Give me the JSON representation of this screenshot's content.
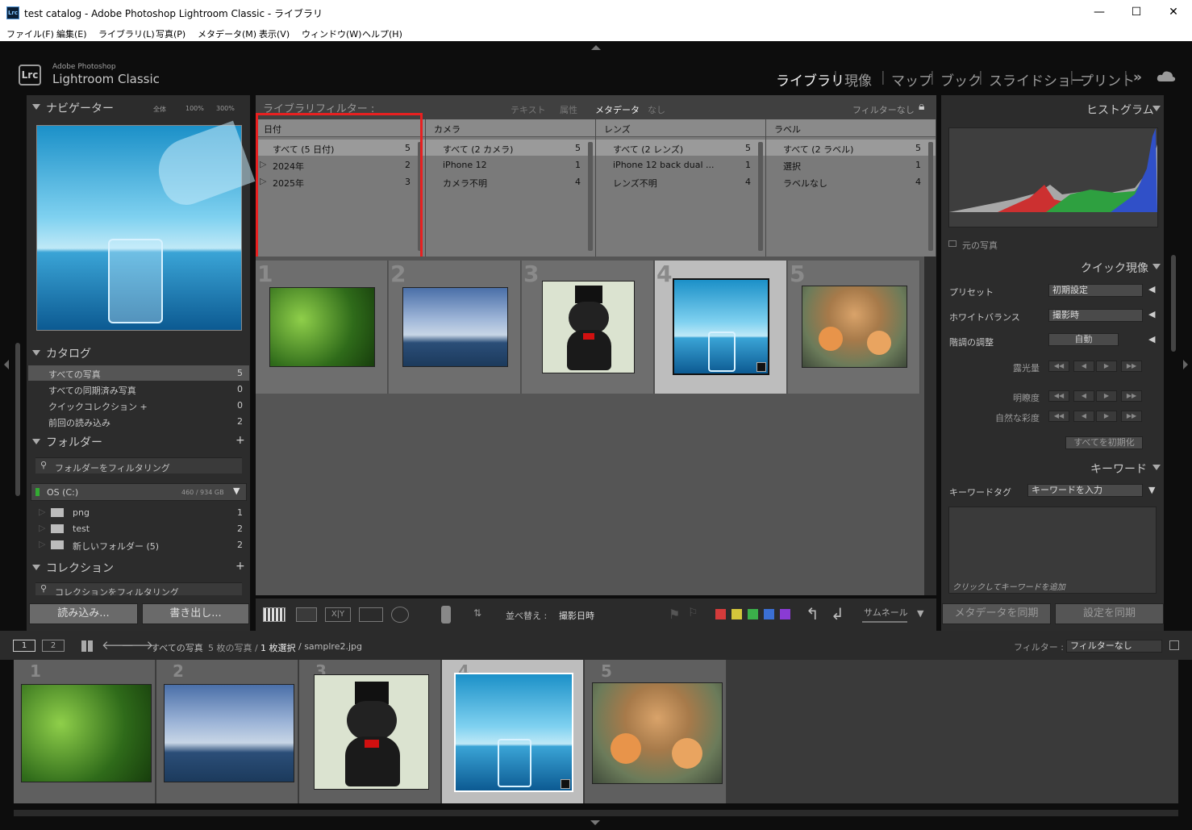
{
  "window": {
    "title": "test catalog - Adobe Photoshop Lightroom Classic - ライブラリ",
    "minimize": "—",
    "maximize": "☐",
    "close": "✕"
  },
  "menu": [
    "ファイル(F)",
    "編集(E)",
    "ライブラリ(L)",
    "写真(P)",
    "メタデータ(M)",
    "表示(V)",
    "ウィンドウ(W)",
    "ヘルプ(H)"
  ],
  "brand": {
    "logo": "Lrc",
    "small": "Adobe Photoshop",
    "large": "Lightroom Classic"
  },
  "modules": [
    "ライブラリ",
    "現像",
    "マップ",
    "ブック",
    "スライドショー",
    "プリント"
  ],
  "modules_more": "»",
  "left": {
    "navigator": {
      "title": "ナビゲーター",
      "zoom": [
        "全体",
        "100%",
        "300%"
      ]
    },
    "catalog": {
      "title": "カタログ",
      "items": [
        {
          "label": "すべての写真",
          "count": "5"
        },
        {
          "label": "すべての同期済み写真",
          "count": "0"
        },
        {
          "label": "クイックコレクション +",
          "count": "0"
        },
        {
          "label": "前回の読み込み",
          "count": "2"
        }
      ]
    },
    "folders": {
      "title": "フォルダー",
      "filter_placeholder": "フォルダーをフィルタリング",
      "volume": "OS (C:)",
      "volume_size": "460 / 934 GB",
      "items": [
        {
          "label": "png",
          "count": "1"
        },
        {
          "label": "test",
          "count": "2"
        },
        {
          "label": "新しいフォルダー (5)",
          "count": "2"
        }
      ]
    },
    "collections": {
      "title": "コレクション",
      "filter_placeholder": "コレクションをフィルタリング"
    },
    "import_label": "読み込み...",
    "export_label": "書き出し..."
  },
  "filterbar": {
    "title": "ライブラリフィルター :",
    "tabs": [
      "テキスト",
      "属性",
      "メタデータ",
      "なし"
    ],
    "preset": "フィルターなし"
  },
  "metadata_columns": [
    {
      "header": "日付",
      "rows": [
        {
          "label": "すべて (5 日付)",
          "count": "5",
          "sel": true
        },
        {
          "label": "2024年",
          "count": "2",
          "exp": true
        },
        {
          "label": "2025年",
          "count": "3",
          "exp": true
        }
      ]
    },
    {
      "header": "カメラ",
      "rows": [
        {
          "label": "すべて (2 カメラ)",
          "count": "5",
          "sel": true
        },
        {
          "label": "iPhone 12",
          "count": "1"
        },
        {
          "label": "カメラ不明",
          "count": "4"
        }
      ]
    },
    {
      "header": "レンズ",
      "rows": [
        {
          "label": "すべて (2 レンズ)",
          "count": "5",
          "sel": true
        },
        {
          "label": "iPhone 12 back dual ...",
          "count": "1"
        },
        {
          "label": "レンズ不明",
          "count": "4"
        }
      ]
    },
    {
      "header": "ラベル",
      "rows": [
        {
          "label": "すべて (2 ラベル)",
          "count": "5",
          "sel": true
        },
        {
          "label": "選択",
          "count": "1"
        },
        {
          "label": "ラベルなし",
          "count": "4"
        }
      ]
    }
  ],
  "grid_numbers": [
    "1",
    "2",
    "3",
    "4",
    "5"
  ],
  "toolbar": {
    "sort_label": "並べ替え :",
    "sort_value": "撮影日時",
    "thumb_label": "サムネール"
  },
  "right": {
    "histogram": {
      "title": "ヒストグラム",
      "original": "元の写真"
    },
    "quick": {
      "title": "クイック現像",
      "preset_label": "プリセット",
      "preset_value": "初期設定",
      "wb_label": "ホワイトバランス",
      "wb_value": "撮影時",
      "tone_label": "階調の調整",
      "auto": "自動",
      "exposure": "露光量",
      "clarity": "明瞭度",
      "vibrance": "自然な彩度",
      "reset": "すべてを初期化"
    },
    "keywords": {
      "title": "キーワード",
      "tag_label": "キーワードタグ",
      "tag_value": "キーワードを入力",
      "add_hint": "クリックしてキーワードを追加"
    },
    "sync_meta": "メタデータを同期",
    "sync_settings": "設定を同期"
  },
  "filmstrip_bar": {
    "page1": "1",
    "page2": "2",
    "path_a": "すべての写真",
    "path_b": "5 枚の写真 /",
    "path_c": "1 枚選択",
    "path_d": "/ samplre2.jpg",
    "filter_label": "フィルター :",
    "filter_value": "フィルターなし"
  },
  "filmstrip_numbers": [
    "1",
    "2",
    "3",
    "4",
    "5"
  ]
}
